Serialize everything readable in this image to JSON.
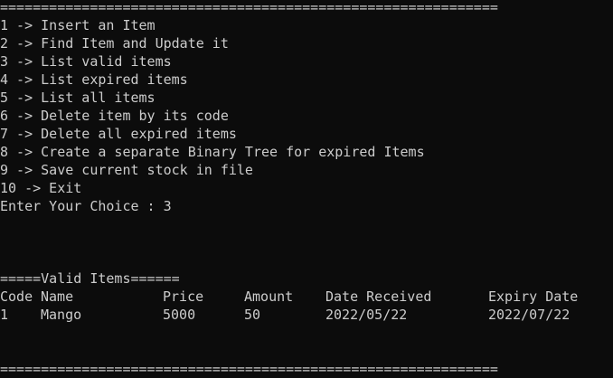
{
  "separator": "=============================================================",
  "menu": [
    "1 -> Insert an Item",
    "2 -> Find Item and Update it",
    "3 -> List valid items",
    "4 -> List expired items",
    "5 -> List all items",
    "6 -> Delete item by its code",
    "7 -> Delete all expired items",
    "8 -> Create a separate Binary Tree for expired Items",
    "9 -> Save current stock in file",
    "10 -> Exit"
  ],
  "prompt": "Enter Your Choice : 3",
  "section_title": "=====Valid Items======",
  "table": {
    "headers": [
      "Code",
      "Name",
      "Price",
      "Amount",
      "Date Received",
      "Expiry Date"
    ],
    "rows": [
      [
        "1",
        "Mango",
        "5000",
        "50",
        "2022/05/22",
        "2022/07/22"
      ]
    ]
  }
}
